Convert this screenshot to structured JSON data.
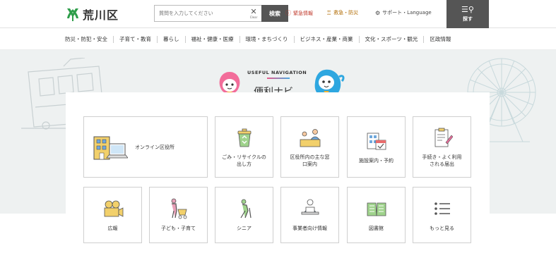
{
  "header": {
    "logo_text": "荒川区",
    "search_placeholder": "質問を入力してください",
    "clear_label": "Clear",
    "search_button": "検索",
    "emergency": "緊急情報",
    "rescue": "救急・防災",
    "support": "サポート・Language",
    "find_button": "探す"
  },
  "nav": {
    "categories": [
      "防災・防犯・安全",
      "子育て・教育",
      "暮らし",
      "福祉・健康・医療",
      "環境・まちづくり",
      "ビジネス・産業・商業",
      "文化・スポーツ・観光",
      "区政情報"
    ]
  },
  "section": {
    "kicker": "USEFUL NAVIGATION",
    "title": "便利ナビ"
  },
  "tiles": [
    {
      "label": "オンライン区役所",
      "icon": "online-office-icon"
    },
    {
      "label": "ごみ・リサイクルの\n出し方",
      "icon": "recycle-bin-icon"
    },
    {
      "label": "区役所内の主な窓\n口案内",
      "icon": "reception-icon"
    },
    {
      "label": "施設案内・予約",
      "icon": "facility-calendar-icon"
    },
    {
      "label": "手続き・よく利用\nされる届出",
      "icon": "clipboard-icon"
    },
    {
      "label": "広報",
      "icon": "camera-icon"
    },
    {
      "label": "子ども・子育て",
      "icon": "parent-stroller-icon"
    },
    {
      "label": "シニア",
      "icon": "senior-icon"
    },
    {
      "label": "事業者向け情報",
      "icon": "business-person-icon"
    },
    {
      "label": "図書館",
      "icon": "book-icon"
    },
    {
      "label": "もっと見る",
      "icon": "list-icon"
    }
  ],
  "colors": {
    "accent_green": "#2e9e4a",
    "emergency_red": "#c0392b",
    "rescue_orange": "#b06a00",
    "band_grey": "#eef1f1",
    "dark_button": "#555555"
  }
}
